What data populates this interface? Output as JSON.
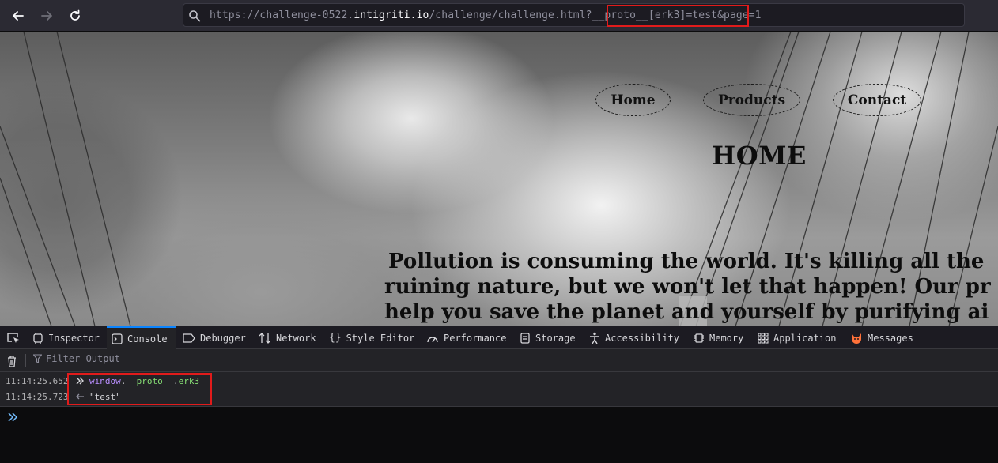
{
  "browser": {
    "url": {
      "scheme_host_prefix": "https://challenge-0522.",
      "domain": "intigriti.io",
      "path": "/challenge/challenge.html",
      "query_highlighted": "?__proto__[erk3]=test",
      "query_rest": "&page=1"
    }
  },
  "page": {
    "nav": [
      "Home",
      "Products",
      "Contact"
    ],
    "title": "HOME",
    "intro_lines": [
      "Pollution is consuming the world. It's killing all the",
      "ruining nature, but we won't let that happen! Our pr",
      "help you save the planet and yourself by purifying ai"
    ]
  },
  "devtools": {
    "tabs": [
      {
        "label": "Inspector",
        "icon": "inspector-icon"
      },
      {
        "label": "Console",
        "icon": "console-icon"
      },
      {
        "label": "Debugger",
        "icon": "debugger-icon"
      },
      {
        "label": "Network",
        "icon": "network-icon"
      },
      {
        "label": "Style Editor",
        "icon": "style-editor-icon"
      },
      {
        "label": "Performance",
        "icon": "performance-icon"
      },
      {
        "label": "Storage",
        "icon": "storage-icon"
      },
      {
        "label": "Accessibility",
        "icon": "accessibility-icon"
      },
      {
        "label": "Memory",
        "icon": "memory-icon"
      },
      {
        "label": "Application",
        "icon": "application-icon"
      },
      {
        "label": "Messages",
        "icon": "messages-icon"
      }
    ],
    "active_tab": "Console",
    "filter_placeholder": "Filter Output",
    "console": {
      "input_time": "11:14:25.652",
      "input_text": {
        "obj": "window",
        "prop": "__proto__",
        "key": "erk3"
      },
      "result_time": "11:14:25.723",
      "result_text": "\"test\""
    }
  },
  "colors": {
    "accent": "#0a84ff",
    "highlight_box": "#e11b1b",
    "console_keyword": "#b98eff",
    "console_prop": "#86de74"
  }
}
